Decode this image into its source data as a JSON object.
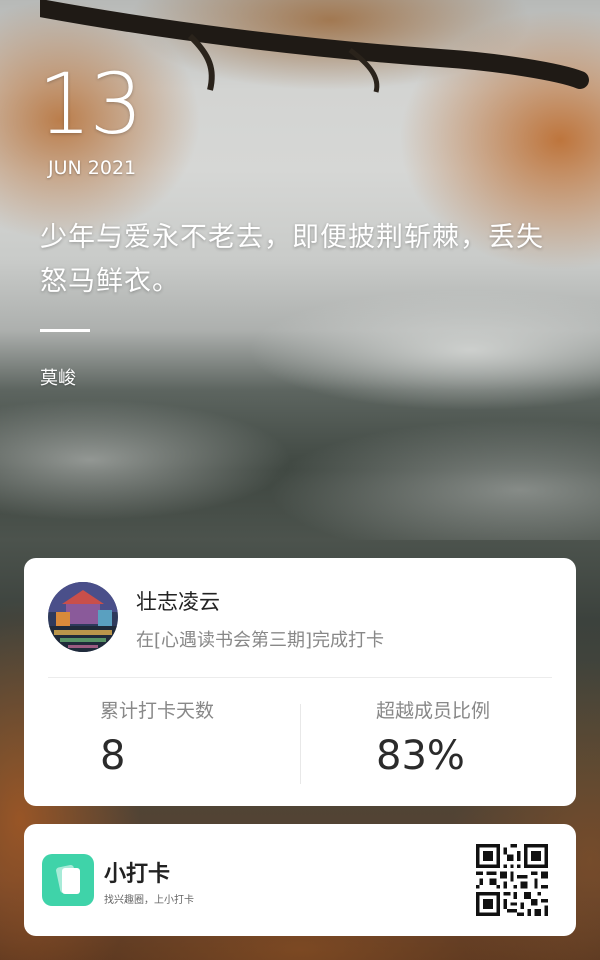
{
  "date": {
    "day": "13",
    "month_year": "JUN 2021"
  },
  "quote": {
    "text": "少年与爱永不老去，即便披荆斩棘，丢失怒马鲜衣。",
    "author": "莫峻"
  },
  "user_card": {
    "name": "壮志凌云",
    "description": "在[心遇读书会第三期]完成打卡",
    "stats": [
      {
        "label": "累计打卡天数",
        "value": "8"
      },
      {
        "label": "超越成员比例",
        "value": "83%"
      }
    ]
  },
  "brand": {
    "name": "小打卡",
    "slogan": "找兴趣圈，上小打卡",
    "logo_icon": "card-stack-icon",
    "logo_color": "#3fd3a9",
    "qr_icon": "qr-code-icon"
  }
}
